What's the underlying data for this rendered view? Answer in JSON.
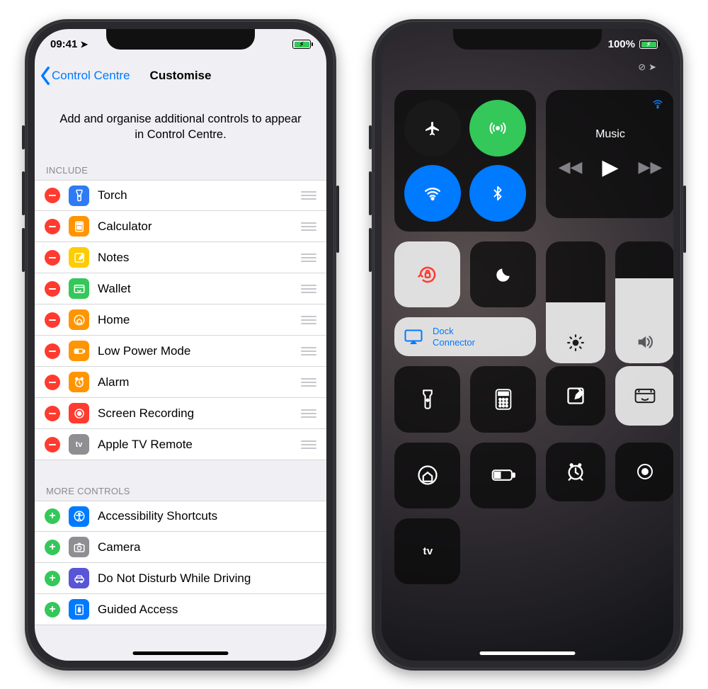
{
  "left": {
    "status": {
      "time": "09:41"
    },
    "nav": {
      "back": "Control Centre",
      "title": "Customise"
    },
    "description": "Add and organise additional controls to appear in Control Centre.",
    "section_include": "INCLUDE",
    "include": [
      {
        "label": "Torch",
        "color": "#2f7af5",
        "icon": "torch"
      },
      {
        "label": "Calculator",
        "color": "#ff9500",
        "icon": "calculator"
      },
      {
        "label": "Notes",
        "color": "#ffcc00",
        "icon": "notes"
      },
      {
        "label": "Wallet",
        "color": "#34c759",
        "icon": "wallet"
      },
      {
        "label": "Home",
        "color": "#ff9500",
        "icon": "home"
      },
      {
        "label": "Low Power Mode",
        "color": "#ff9500",
        "icon": "battery"
      },
      {
        "label": "Alarm",
        "color": "#ff9500",
        "icon": "alarm"
      },
      {
        "label": "Screen Recording",
        "color": "#ff3b30",
        "icon": "record"
      },
      {
        "label": "Apple TV Remote",
        "color": "#8e8e93",
        "icon": "tv"
      }
    ],
    "section_more": "MORE CONTROLS",
    "more": [
      {
        "label": "Accessibility Shortcuts",
        "color": "#007aff",
        "icon": "accessibility"
      },
      {
        "label": "Camera",
        "color": "#8e8e93",
        "icon": "camera"
      },
      {
        "label": "Do Not Disturb While Driving",
        "color": "#5856d6",
        "icon": "car"
      },
      {
        "label": "Guided Access",
        "color": "#007aff",
        "icon": "guided"
      }
    ]
  },
  "right": {
    "status": {
      "battery": "100%"
    },
    "music": {
      "title": "Music"
    },
    "mirror": {
      "line1": "Dock",
      "line2": "Connector"
    },
    "connectivity": {
      "airplane": {
        "on": false
      },
      "cellular": {
        "on": true
      },
      "wifi": {
        "on": true
      },
      "bluetooth": {
        "on": true
      }
    },
    "orientation_lock": true,
    "dnd": false,
    "brightness_pct": 50,
    "volume_pct": 70,
    "tiles": [
      "torch",
      "calculator",
      "notes",
      "wallet",
      "home",
      "lowpower",
      "alarm",
      "record",
      "appletv"
    ]
  }
}
